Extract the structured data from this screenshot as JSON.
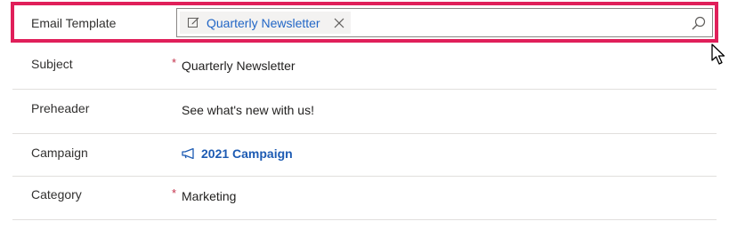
{
  "fields": {
    "email_template": {
      "label": "Email Template",
      "value": "Quarterly Newsletter",
      "icon": "edit-icon"
    },
    "subject": {
      "label": "Subject",
      "required_marker": "*",
      "value": "Quarterly Newsletter"
    },
    "preheader": {
      "label": "Preheader",
      "value": "See what's new with us!"
    },
    "campaign": {
      "label": "Campaign",
      "value": "2021 Campaign",
      "icon": "megaphone-icon"
    },
    "category": {
      "label": "Category",
      "required_marker": "*",
      "value": "Marketing"
    }
  },
  "colors": {
    "highlight_border": "#e01f5a",
    "link": "#1d5bb3",
    "required": "#c4314b",
    "divider": "#e1dfdd"
  }
}
